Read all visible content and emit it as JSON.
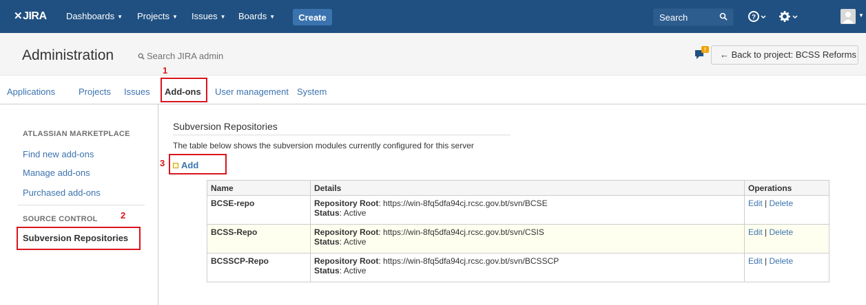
{
  "topbar": {
    "logo": "JIRA",
    "nav": [
      {
        "label": "Dashboards"
      },
      {
        "label": "Projects"
      },
      {
        "label": "Issues"
      },
      {
        "label": "Boards"
      }
    ],
    "create_label": "Create",
    "search_placeholder": "Search",
    "icons": [
      "search-icon",
      "help-icon",
      "gear-icon",
      "user-avatar"
    ]
  },
  "admin": {
    "title": "Administration",
    "search_text": "Search JIRA admin",
    "back_label": "← Back to project: BCSS Reforms"
  },
  "tabs": [
    {
      "label": "Applications"
    },
    {
      "label": "Projects"
    },
    {
      "label": "Issues"
    },
    {
      "label": "Add-ons"
    },
    {
      "label": "User management"
    },
    {
      "label": "System"
    }
  ],
  "sidebar": {
    "heading1": "ATLASSIAN MARKETPLACE",
    "links1": [
      "Find new add-ons",
      "Manage add-ons",
      "Purchased add-ons"
    ],
    "heading2": "SOURCE CONTROL",
    "active_link": "Subversion Repositories"
  },
  "main": {
    "title": "Subversion Repositories",
    "description": "The table below shows the subversion modules currently configured for this server",
    "add_label": "Add",
    "columns": [
      "Name",
      "Details",
      "Operations"
    ],
    "detail_labels": {
      "root": "Repository Root",
      "status": "Status"
    },
    "ops": {
      "edit": "Edit",
      "sep": " | ",
      "delete": "Delete"
    },
    "rows": [
      {
        "name": "BCSE-repo",
        "root": "https://win-8fq5dfa94cj.rcsc.gov.bt/svn/BCSE",
        "status": "Active"
      },
      {
        "name": "BCSS-Repo",
        "root": "https://win-8fq5dfa94cj.rcsc.gov.bt/svn/CSIS",
        "status": "Active"
      },
      {
        "name": "BCSSCP-Repo",
        "root": "https://win-8fq5dfa94cj.rcsc.gov.bt/svn/BCSSCP",
        "status": "Active"
      }
    ]
  },
  "annotations": [
    "1",
    "2",
    "3"
  ],
  "colors": {
    "topbar": "#205081",
    "link": "#3b73af",
    "annotation": "#d9141b"
  }
}
